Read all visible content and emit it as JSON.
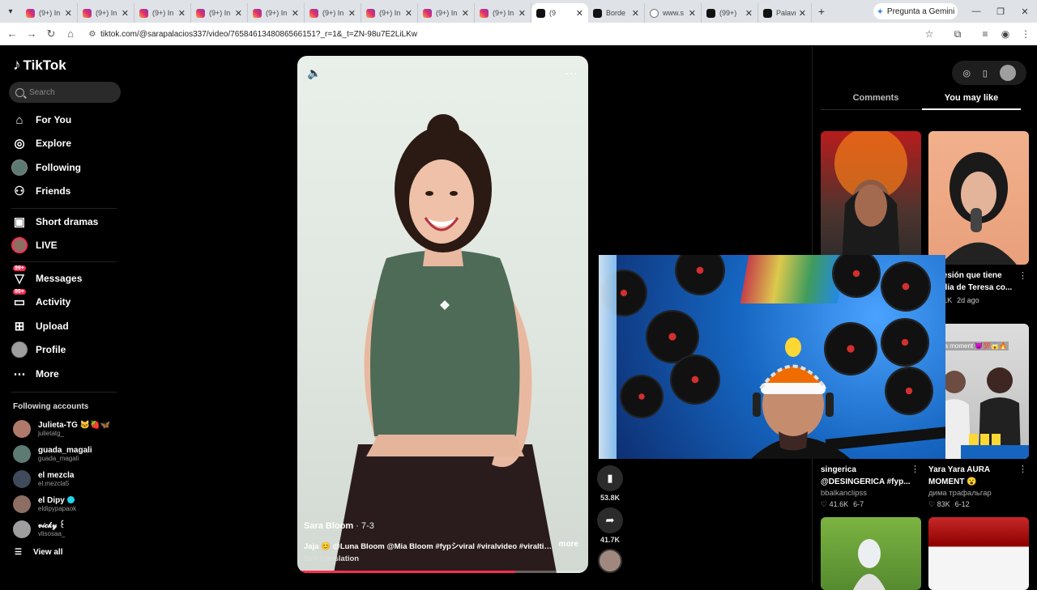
{
  "browser": {
    "tabs": [
      {
        "label": "(9+) In",
        "icon": "instagram-icon"
      },
      {
        "label": "(9+) In",
        "icon": "instagram-icon"
      },
      {
        "label": "(9+) In",
        "icon": "instagram-icon"
      },
      {
        "label": "(9+) In",
        "icon": "instagram-icon"
      },
      {
        "label": "(9+) In",
        "icon": "instagram-icon"
      },
      {
        "label": "(9+) In",
        "icon": "instagram-icon"
      },
      {
        "label": "(9+) In",
        "icon": "instagram-icon"
      },
      {
        "label": "(9+) In",
        "icon": "instagram-icon"
      },
      {
        "label": "(9+) In",
        "icon": "instagram-icon"
      },
      {
        "label": "(9",
        "icon": "tiktok-icon",
        "active": true
      },
      {
        "label": "Borde",
        "icon": "tiktok-icon"
      },
      {
        "label": "www.s",
        "icon": "globe-icon"
      },
      {
        "label": "(99+)",
        "icon": "tiktok-icon"
      },
      {
        "label": "Palavr",
        "icon": "tiktok-icon"
      }
    ],
    "gemini_label": "Pregunta a Gemini",
    "url": "tiktok.com/@sarapalacios337/video/7658461348086566151?_r=1&_t=ZN-98u7E2LiLKw"
  },
  "sidebar": {
    "logo": "TikTok",
    "search_placeholder": "Search",
    "nav": [
      {
        "label": "For You",
        "icon": "home-icon"
      },
      {
        "label": "Explore",
        "icon": "compass-icon"
      },
      {
        "label": "Following",
        "icon": "following-avatar"
      },
      {
        "label": "Friends",
        "icon": "friends-icon"
      },
      {
        "label": "Short dramas",
        "icon": "film-icon"
      },
      {
        "label": "LIVE",
        "icon": "live-avatar"
      },
      {
        "label": "Messages",
        "icon": "messages-icon",
        "badge": "99+"
      },
      {
        "label": "Activity",
        "icon": "activity-icon",
        "badge": "99+"
      },
      {
        "label": "Upload",
        "icon": "upload-icon"
      },
      {
        "label": "Profile",
        "icon": "profile-avatar"
      },
      {
        "label": "More",
        "icon": "more-icon"
      }
    ],
    "following_title": "Following accounts",
    "following": [
      {
        "name": "Julieta-TG 🐱🍓🦋",
        "handle": "julietatg_",
        "color": "#b07a6a"
      },
      {
        "name": "guada_magali",
        "handle": "guada_magali",
        "color": "#5d7a73"
      },
      {
        "name": "el mezcla",
        "handle": "el.mezcla5",
        "color": "#3f4a5a"
      },
      {
        "name": "el Dipy",
        "handle": "eldipypapaok",
        "color": "#8d6e63",
        "verified": true
      },
      {
        "name": "𝓋𝒾𝒸𝓀𝓎 ꒰",
        "handle": "vlisosaa_",
        "color": "#9e9e9e"
      }
    ],
    "view_all": "View all"
  },
  "video": {
    "author": "Sara Bloom",
    "date": " · 7-3",
    "caption": "Jaja 😊 @Luna Bloom @Mia Bloom #fypシviral #viralvideo #viraltikt...",
    "more": "more",
    "see_translation": "See translation",
    "progress": 0.75
  },
  "actions": {
    "bookmark_count": "53.8K",
    "share_count": "41.7K"
  },
  "right_panel": {
    "tabs": [
      "Comments",
      "You may like"
    ],
    "active_tab": "You may like",
    "cards": [
      {
        "title": "",
        "author": "",
        "likes": "",
        "date": ""
      },
      {
        "title": "obsesión que tiene familia de Teresa co...",
        "author": "",
        "likes": "9.1K",
        "date": "2d ago"
      },
      {
        "title": "singerica @DESINGERICA #fyp...",
        "author": "bbalkanclipss",
        "likes": "41.6K",
        "date": "6-7"
      },
      {
        "title": "Yara Yara AURA MOMENT 😮",
        "author": "дима трафальгар",
        "likes": "83K",
        "date": "6-12"
      }
    ],
    "aura_overlay": "aura moment 😈💯😱🔥"
  }
}
